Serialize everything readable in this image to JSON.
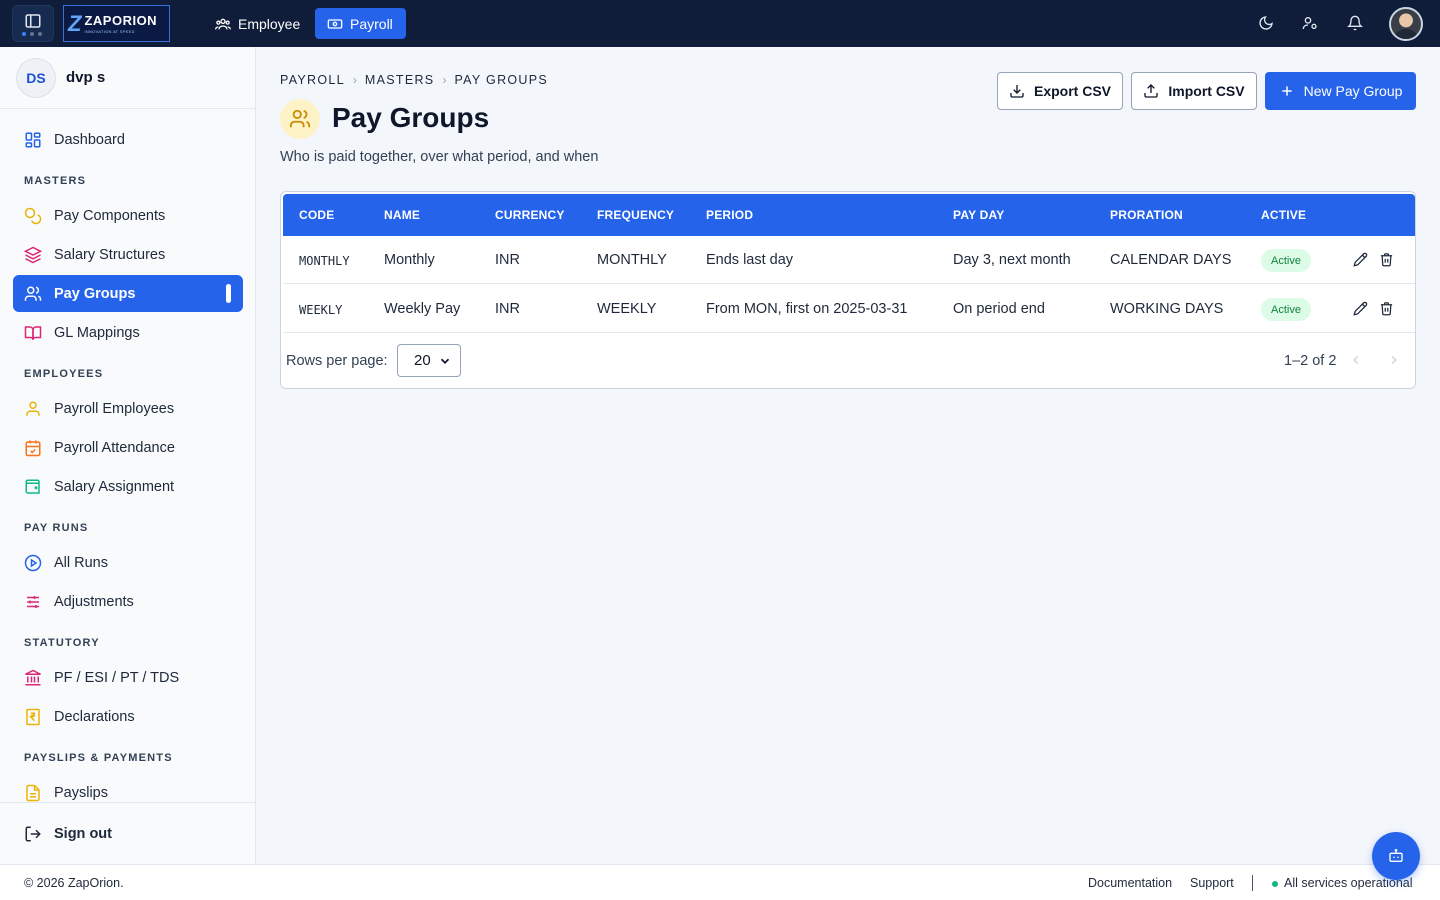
{
  "topbar": {
    "logo_name": "ZAPORION",
    "logo_tagline": "INNOVATION AT SPEED",
    "tabs": [
      {
        "label": "Employee",
        "active": false
      },
      {
        "label": "Payroll",
        "active": true
      }
    ],
    "icons": [
      "sidebar-toggle-icon",
      "moon-icon",
      "user-switch-icon",
      "bell-icon"
    ]
  },
  "sidebar": {
    "user_initials": "DS",
    "user_name": "dvp s",
    "dashboard": "Dashboard",
    "sections": {
      "masters": "MASTERS",
      "employees": "EMPLOYEES",
      "pay_runs": "PAY RUNS",
      "statutory": "STATUTORY",
      "payslips": "PAYSLIPS & PAYMENTS"
    },
    "items": {
      "pay_components": "Pay Components",
      "salary_structures": "Salary Structures",
      "pay_groups": "Pay Groups",
      "gl_mappings": "GL Mappings",
      "payroll_employees": "Payroll Employees",
      "payroll_attendance": "Payroll Attendance",
      "salary_assignment": "Salary Assignment",
      "all_runs": "All Runs",
      "adjustments": "Adjustments",
      "statutory": "PF / ESI / PT / TDS",
      "declarations": "Declarations",
      "payslips": "Payslips"
    },
    "sign_out": "Sign out"
  },
  "main": {
    "breadcrumb": [
      "PAYROLL",
      "MASTERS",
      "PAY GROUPS"
    ],
    "title": "Pay Groups",
    "subtitle": "Who is paid together, over what period, and when",
    "buttons": {
      "export": "Export CSV",
      "import": "Import CSV",
      "new": "New Pay Group"
    },
    "table": {
      "headers": {
        "code": "CODE",
        "name": "NAME",
        "currency": "CURRENCY",
        "frequency": "FREQUENCY",
        "period": "PERIOD",
        "pay_day": "PAY DAY",
        "proration": "PRORATION",
        "active": "ACTIVE"
      },
      "rows": [
        {
          "code": "MONTHLY",
          "name": "Monthly",
          "currency": "INR",
          "frequency": "MONTHLY",
          "period": "Ends last day",
          "pay_day": "Day 3, next month",
          "proration": "CALENDAR DAYS",
          "active": "Active"
        },
        {
          "code": "WEEKLY",
          "name": "Weekly Pay",
          "currency": "INR",
          "frequency": "WEEKLY",
          "period": "From MON, first on 2025-03-31",
          "pay_day": "On period end",
          "proration": "WORKING DAYS",
          "active": "Active"
        }
      ],
      "rows_per_page_label": "Rows per page:",
      "rows_per_page_value": "20",
      "range": "1–2 of 2"
    }
  },
  "footer": {
    "copyright": "© 2026 ZapOrion.",
    "documentation": "Documentation",
    "support": "Support",
    "status": "All services operational"
  },
  "colors": {
    "primary": "#2563eb",
    "topbar": "#0f1d3a",
    "active_badge_bg": "#dcfce7",
    "active_badge_text": "#15803d",
    "status_ok": "#10b981"
  }
}
